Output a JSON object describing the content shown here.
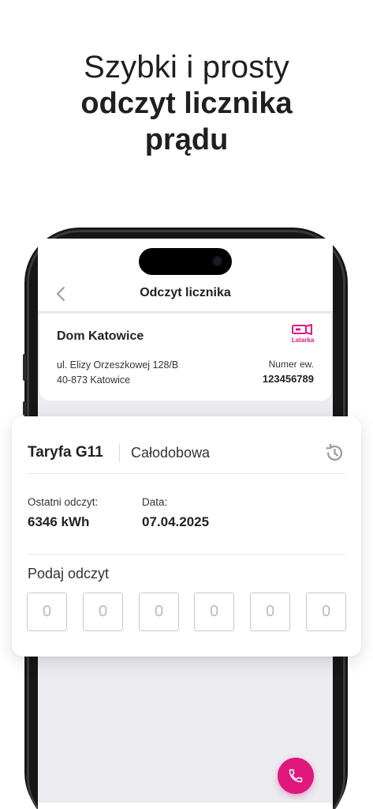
{
  "headline": {
    "line1": "Szybki i prosty",
    "line2": "odczyt licznika",
    "line3": "prądu"
  },
  "header": {
    "title": "Odczyt licznika",
    "back_icon": "chevron-left-icon"
  },
  "location": {
    "name": "Dom Katowice",
    "address_line1": "ul. Elizy Orzeszkowej 128/B",
    "address_line2": "40-873 Katowice",
    "flashlight_label": "Latarka",
    "meter_label": "Numer ew.",
    "meter_number": "123456789"
  },
  "reading": {
    "tariff": "Taryfa G11",
    "tariff_mode": "Całodobowa",
    "history_icon": "history-icon",
    "last_reading_label": "Ostatni odczyt:",
    "last_reading_value": "6346 kWh",
    "date_label": "Data:",
    "date_value": "07.04.2025",
    "input_label": "Podaj odczyt",
    "digits": [
      "0",
      "0",
      "0",
      "0",
      "0",
      "0"
    ]
  },
  "fab": {
    "icon": "phone-icon"
  },
  "colors": {
    "accent": "#e0187e",
    "background": "#ebebf0",
    "text": "#222222"
  }
}
